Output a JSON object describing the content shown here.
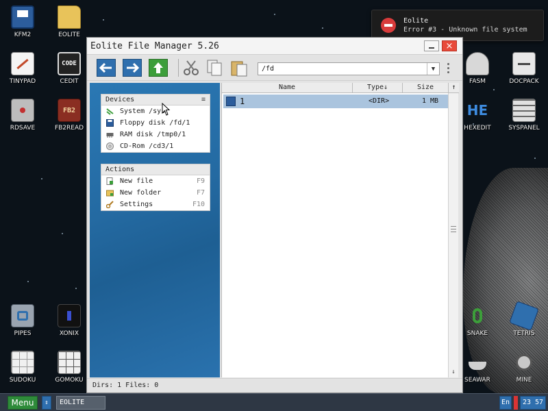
{
  "desktop": {
    "left_icons": [
      {
        "label": "KFM2",
        "icon": "floppy-icon"
      },
      {
        "label": "EOLITE",
        "icon": "folder-icon"
      },
      {
        "label": "TINYPAD",
        "icon": "notepad-icon"
      },
      {
        "label": "CEDIT",
        "icon": "code-icon"
      },
      {
        "label": "RDSAVE",
        "icon": "rdsave-icon"
      },
      {
        "label": "FB2READ",
        "icon": "book-icon"
      },
      {
        "label": "PIPES",
        "icon": "pipes-icon"
      },
      {
        "label": "XONIX",
        "icon": "xonix-icon"
      },
      {
        "label": "SUDOKU",
        "icon": "sudoku-icon"
      },
      {
        "label": "GOMOKU",
        "icon": "gomoku-icon"
      }
    ],
    "right_icons": [
      {
        "label": "FASM",
        "icon": "fasm-icon"
      },
      {
        "label": "DOCPACK",
        "icon": "docpack-icon"
      },
      {
        "label": "HEXEDIT",
        "icon": "hex-icon"
      },
      {
        "label": "SYSPANEL",
        "icon": "syspanel-icon"
      },
      {
        "label": "SNAKE",
        "icon": "snake-icon"
      },
      {
        "label": "TETRIS",
        "icon": "tetris-icon"
      },
      {
        "label": "SEAWAR",
        "icon": "ship-icon"
      },
      {
        "label": "MINE",
        "icon": "mine-icon"
      }
    ],
    "cedit_glyph": "CODE",
    "fb2_glyph": "FB2",
    "hex_glyph": "HE"
  },
  "notification": {
    "title": "Eolite",
    "message": "Error #3 - Unknown file system"
  },
  "window": {
    "title": "Eolite File Manager 5.26",
    "path": "/fd",
    "devices": {
      "header": "Devices",
      "header_icon": "≡",
      "items": [
        {
          "label": "System /sys",
          "icon": "system-icon"
        },
        {
          "label": "Floppy disk /fd/1",
          "icon": "floppy-icon"
        },
        {
          "label": "RAM disk /tmp0/1",
          "icon": "ram-icon"
        },
        {
          "label": "CD-Rom /cd3/1",
          "icon": "cd-icon"
        }
      ]
    },
    "actions": {
      "header": "Actions",
      "items": [
        {
          "label": "New file",
          "key": "F9",
          "icon": "new-file-icon"
        },
        {
          "label": "New folder",
          "key": "F7",
          "icon": "new-folder-icon"
        },
        {
          "label": "Settings",
          "key": "F10",
          "icon": "settings-icon"
        }
      ]
    },
    "columns": {
      "name": "Name",
      "type": "Type↓",
      "size": "Size",
      "scroll_up": "↑"
    },
    "files": [
      {
        "name": "1",
        "type": "<DIR>",
        "size": "1 MB"
      }
    ],
    "status": "Dirs: 1   Files: 0"
  },
  "taskbar": {
    "menu": "Menu",
    "switcher": "⇕",
    "task": "EOLITE",
    "lang": "En",
    "clock": "23 57"
  },
  "colors": {
    "accent_blue": "#2f6fae",
    "selection": "#aac4de",
    "close_red": "#e84a3a",
    "menu_green": "#2e8b3a"
  }
}
